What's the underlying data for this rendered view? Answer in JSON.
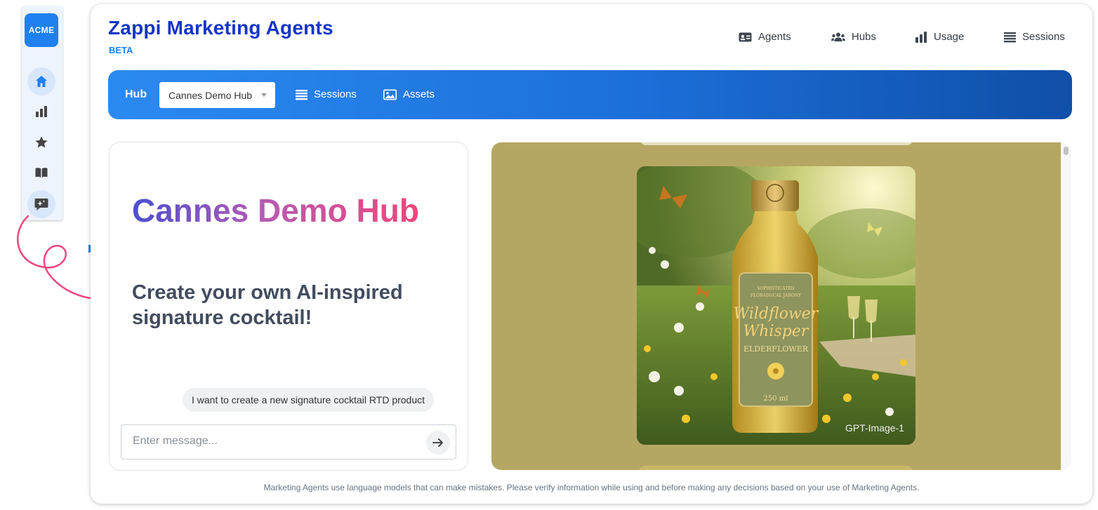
{
  "sidebar": {
    "logo": "ACME",
    "items": [
      {
        "icon": "home-icon",
        "active": true
      },
      {
        "icon": "chart-icon",
        "active": false
      },
      {
        "icon": "star-icon",
        "active": false
      },
      {
        "icon": "book-icon",
        "active": false
      },
      {
        "icon": "ai-chat-icon",
        "active": false
      }
    ]
  },
  "header": {
    "title": "Zappi Marketing Agents",
    "badge": "BETA",
    "nav": [
      {
        "label": "Agents",
        "icon": "id-card-icon"
      },
      {
        "label": "Hubs",
        "icon": "users-icon"
      },
      {
        "label": "Usage",
        "icon": "bar-chart-icon"
      },
      {
        "label": "Sessions",
        "icon": "list-icon"
      }
    ]
  },
  "hubbar": {
    "label": "Hub",
    "selected_hub": "Cannes Demo Hub",
    "links": [
      {
        "label": "Sessions",
        "icon": "list-icon"
      },
      {
        "label": "Assets",
        "icon": "image-icon"
      }
    ]
  },
  "panel": {
    "title": "Cannes Demo Hub",
    "subtitle": "Create your own AI-inspired signature cocktail!",
    "suggestion": "I want to create a new signature cocktail RTD product",
    "input_placeholder": "Enter message..."
  },
  "gallery": {
    "image": {
      "label_top": "SOPHISTICATED FLORADUCAL JARONY",
      "label_name_line1": "Wildflower",
      "label_name_line2": "Whisper",
      "label_flavor": "ELDERFLOWER",
      "label_volume": "250 ml",
      "caption": "GPT-Image-1"
    }
  },
  "footer": {
    "disclaimer": "Marketing Agents use language models that can make mistakes. Please verify information while using and before making any decisions based on your use of Marketing Agents."
  },
  "colors": {
    "brand_blue": "#1535c7",
    "accent_blue": "#1f80ef",
    "hub_gradient_start": "#2b8af2",
    "hub_gradient_end": "#0f4fa8",
    "title_gradient_start": "#4a4fd0",
    "title_gradient_end": "#f0467a",
    "doodle_pink": "#f0457e"
  }
}
